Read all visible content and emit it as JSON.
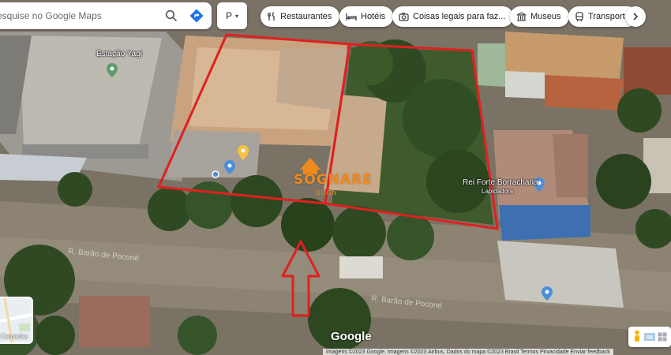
{
  "search": {
    "placeholder": "esquise no Google Maps",
    "secondary_value": "P",
    "secondary_caret": "▾"
  },
  "chips": [
    {
      "label": "Restaurantes",
      "icon": "fork-knife-icon"
    },
    {
      "label": "Hotéis",
      "icon": "bed-icon"
    },
    {
      "label": "Coisas legais para faz...",
      "icon": "camera-icon"
    },
    {
      "label": "Museus",
      "icon": "museum-icon"
    },
    {
      "label": "Transporte",
      "icon": "train-icon"
    }
  ],
  "places": {
    "estacao": "Estação Yagi",
    "rei_forte": "Rei Forte Borracharia",
    "rei_forte_sub": "Lapidadora"
  },
  "streets": {
    "main_street": "R. Barão de Poconé",
    "secondary_street": "R. Barão de Poconé"
  },
  "watermark": {
    "brand": "SOGNARE",
    "sub": "SOGN"
  },
  "map_chrome": {
    "google_logo": "Google",
    "layers_label": "Camadas",
    "attribution": "Imagens ©2023 Google, Imagens ©2023 Airbus, Dados do mapa ©2023   Brasil   Termos   Privacidade   Enviar feedback"
  },
  "colors": {
    "annotation_red": "#e02020",
    "watermark_orange": "#f08a1c",
    "pin_blue": "#4a90d9",
    "pin_yellow": "#f5c242",
    "pin_green": "#5d9b6b"
  }
}
